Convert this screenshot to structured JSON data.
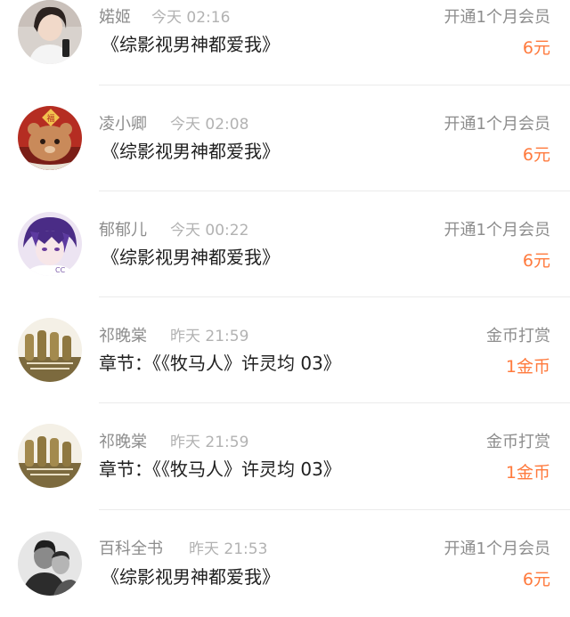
{
  "rows": [
    {
      "user": "婼姬",
      "time": "今天 02:16",
      "content": "《综影视男神都爱我》",
      "action": "开通1个月会员",
      "amount": "6元",
      "avatar_icon": "avatar-photo-girl"
    },
    {
      "user": "凌小卿",
      "time": "今天 02:08",
      "content": "《综影视男神都爱我》",
      "action": "开通1个月会员",
      "amount": "6元",
      "avatar_icon": "avatar-cartoon-bear"
    },
    {
      "user": "郁郁儿",
      "time": "今天 00:22",
      "content": "《综影视男神都爱我》",
      "action": "开通1个月会员",
      "amount": "6元",
      "avatar_icon": "avatar-anime-boy"
    },
    {
      "user": "祁晚棠",
      "time": "昨天 21:59",
      "content": "章节：《《牧马人》许灵均 03》",
      "action": "金币打赏",
      "amount": "1金币",
      "avatar_icon": "avatar-bottles"
    },
    {
      "user": "祁晚棠",
      "time": "昨天 21:59",
      "content": "章节：《《牧马人》许灵均 03》",
      "action": "金币打赏",
      "amount": "1金币",
      "avatar_icon": "avatar-bottles"
    },
    {
      "user": "百科全书",
      "time": "昨天 21:53",
      "content": "《综影视男神都爱我》",
      "action": "开通1个月会员",
      "amount": "6元",
      "avatar_icon": "avatar-bw-photo"
    }
  ],
  "colors": {
    "amount": "#ff7a3d",
    "meta": "#8d8d8d",
    "time": "#b2b2b2",
    "title": "#1f1f1f",
    "divider": "#ebebeb"
  }
}
